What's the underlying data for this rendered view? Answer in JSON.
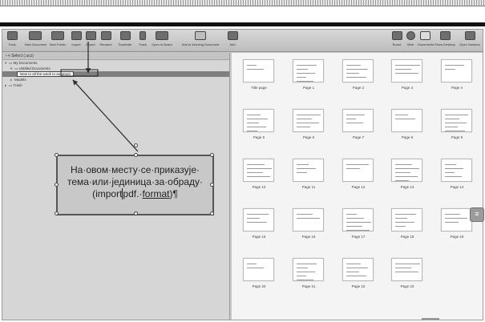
{
  "toolbar": {
    "left_items": [
      "Tools",
      "New Document",
      "New Folder",
      "Import",
      "Export",
      "Rename",
      "Duplicate",
      "Trash",
      "Open in Board",
      "Add to Working Document",
      "Add"
    ],
    "right_items": [
      "Board",
      "Web",
      "Documents",
      "Show Desktop",
      "Open Sankore"
    ]
  },
  "tree": {
    "header": "Select (.ucz)",
    "rows": [
      {
        "label": "My Documents",
        "indent": 0
      },
      {
        "label": "Untitled Documents",
        "indent": 1
      },
      {
        "label": "New to all the week to augment",
        "indent": 2,
        "selected": true
      },
      {
        "label": "Models",
        "indent": 1
      },
      {
        "label": "Trash",
        "indent": 0
      }
    ]
  },
  "callout": {
    "line1": "На·овом·месту·се·приказује·",
    "line2": "тема·или·јединица·за·обраду·",
    "line3_pre": "(import",
    "line3_mid": "pdf.·",
    "line3_link": "format",
    "line3_end": ")¶"
  },
  "pages": [
    "Title page",
    "Page 1",
    "Page 2",
    "Page 3",
    "Page 4",
    "Page 5",
    "Page 6",
    "Page 7",
    "Page 8",
    "Page 9",
    "Page 10",
    "Page 11",
    "Page 12",
    "Page 13",
    "Page 14",
    "Page 15",
    "Page 16",
    "Page 17",
    "Page 18",
    "Page 19",
    "Page 20",
    "Page 21",
    "Page 22",
    "Page 23"
  ]
}
